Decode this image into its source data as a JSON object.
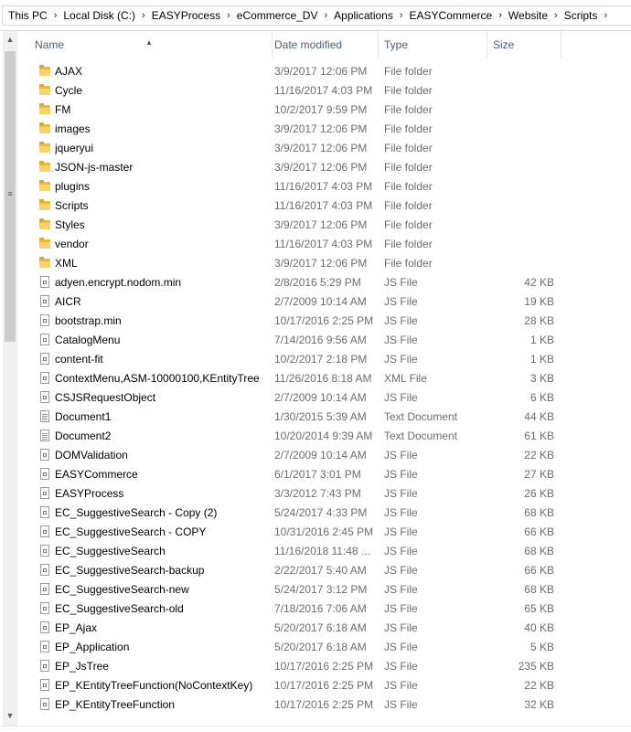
{
  "breadcrumb": [
    "This PC",
    "Local Disk (C:)",
    "EASYProcess",
    "eCommerce_DV",
    "Applications",
    "EASYCommerce",
    "Website",
    "Scripts"
  ],
  "breadcrumb_separator": "›",
  "columns": {
    "name": "Name",
    "date": "Date modified",
    "type": "Type",
    "size": "Size"
  },
  "sort_indicator": "▲",
  "scrollbar": {
    "up": "▲",
    "down": "▼",
    "grip": "≡"
  },
  "files": [
    {
      "name": "AJAX",
      "date": "3/9/2017 12:06 PM",
      "type": "File folder",
      "size": "",
      "icon": "folder-icon"
    },
    {
      "name": "Cycle",
      "date": "11/16/2017 4:03 PM",
      "type": "File folder",
      "size": "",
      "icon": "folder-icon"
    },
    {
      "name": "FM",
      "date": "10/2/2017 9:59 PM",
      "type": "File folder",
      "size": "",
      "icon": "folder-icon"
    },
    {
      "name": "images",
      "date": "3/9/2017 12:06 PM",
      "type": "File folder",
      "size": "",
      "icon": "folder-icon"
    },
    {
      "name": "jqueryui",
      "date": "3/9/2017 12:06 PM",
      "type": "File folder",
      "size": "",
      "icon": "folder-icon"
    },
    {
      "name": "JSON-js-master",
      "date": "3/9/2017 12:06 PM",
      "type": "File folder",
      "size": "",
      "icon": "folder-icon"
    },
    {
      "name": "plugins",
      "date": "11/16/2017 4:03 PM",
      "type": "File folder",
      "size": "",
      "icon": "folder-icon"
    },
    {
      "name": "Scripts",
      "date": "11/16/2017 4:03 PM",
      "type": "File folder",
      "size": "",
      "icon": "folder-icon"
    },
    {
      "name": "Styles",
      "date": "3/9/2017 12:06 PM",
      "type": "File folder",
      "size": "",
      "icon": "folder-icon"
    },
    {
      "name": "vendor",
      "date": "11/16/2017 4:03 PM",
      "type": "File folder",
      "size": "",
      "icon": "folder-icon"
    },
    {
      "name": "XML",
      "date": "3/9/2017 12:06 PM",
      "type": "File folder",
      "size": "",
      "icon": "folder-icon"
    },
    {
      "name": "adyen.encrypt.nodom.min",
      "date": "2/8/2016 5:29 PM",
      "type": "JS File",
      "size": "42 KB",
      "icon": "js-file-icon"
    },
    {
      "name": "AICR",
      "date": "2/7/2009 10:14 AM",
      "type": "JS File",
      "size": "19 KB",
      "icon": "js-file-icon"
    },
    {
      "name": "bootstrap.min",
      "date": "10/17/2016 2:25 PM",
      "type": "JS File",
      "size": "28 KB",
      "icon": "js-file-icon"
    },
    {
      "name": "CatalogMenu",
      "date": "7/14/2016 9:56 AM",
      "type": "JS File",
      "size": "1 KB",
      "icon": "js-file-icon"
    },
    {
      "name": "content-fit",
      "date": "10/2/2017 2:18 PM",
      "type": "JS File",
      "size": "1 KB",
      "icon": "js-file-icon"
    },
    {
      "name": "ContextMenu,ASM-10000100,KEntityTree",
      "date": "11/26/2016 8:18 AM",
      "type": "XML File",
      "size": "3 KB",
      "icon": "xml-file-icon"
    },
    {
      "name": "CSJSRequestObject",
      "date": "2/7/2009 10:14 AM",
      "type": "JS File",
      "size": "6 KB",
      "icon": "js-file-icon"
    },
    {
      "name": "Document1",
      "date": "1/30/2015 5:39 AM",
      "type": "Text Document",
      "size": "44 KB",
      "icon": "text-file-icon"
    },
    {
      "name": "Document2",
      "date": "10/20/2014 9:39 AM",
      "type": "Text Document",
      "size": "61 KB",
      "icon": "text-file-icon"
    },
    {
      "name": "DOMValidation",
      "date": "2/7/2009 10:14 AM",
      "type": "JS File",
      "size": "22 KB",
      "icon": "js-file-icon"
    },
    {
      "name": "EASYCommerce",
      "date": "6/1/2017 3:01 PM",
      "type": "JS File",
      "size": "27 KB",
      "icon": "js-file-icon"
    },
    {
      "name": "EASYProcess",
      "date": "3/3/2012 7:43 PM",
      "type": "JS File",
      "size": "26 KB",
      "icon": "js-file-icon"
    },
    {
      "name": "EC_SuggestiveSearch - Copy (2)",
      "date": "5/24/2017 4:33 PM",
      "type": "JS File",
      "size": "68 KB",
      "icon": "js-file-icon"
    },
    {
      "name": "EC_SuggestiveSearch - COPY",
      "date": "10/31/2016 2:45 PM",
      "type": "JS File",
      "size": "66 KB",
      "icon": "js-file-icon"
    },
    {
      "name": "EC_SuggestiveSearch",
      "date": "11/16/2018 11:48 ...",
      "type": "JS File",
      "size": "68 KB",
      "icon": "js-file-icon"
    },
    {
      "name": "EC_SuggestiveSearch-backup",
      "date": "2/22/2017 5:40 AM",
      "type": "JS File",
      "size": "66 KB",
      "icon": "js-file-icon"
    },
    {
      "name": "EC_SuggestiveSearch-new",
      "date": "5/24/2017 3:12 PM",
      "type": "JS File",
      "size": "68 KB",
      "icon": "js-file-icon"
    },
    {
      "name": "EC_SuggestiveSearch-old",
      "date": "7/18/2016 7:06 AM",
      "type": "JS File",
      "size": "65 KB",
      "icon": "js-file-icon"
    },
    {
      "name": "EP_Ajax",
      "date": "5/20/2017 6:18 AM",
      "type": "JS File",
      "size": "40 KB",
      "icon": "js-file-icon"
    },
    {
      "name": "EP_Application",
      "date": "5/20/2017 6:18 AM",
      "type": "JS File",
      "size": "5 KB",
      "icon": "js-file-icon"
    },
    {
      "name": "EP_JsTree",
      "date": "10/17/2016 2:25 PM",
      "type": "JS File",
      "size": "235 KB",
      "icon": "js-file-icon"
    },
    {
      "name": "EP_KEntityTreeFunction(NoContextKey)",
      "date": "10/17/2016 2:25 PM",
      "type": "JS File",
      "size": "22 KB",
      "icon": "js-file-icon"
    },
    {
      "name": "EP_KEntityTreeFunction",
      "date": "10/17/2016 2:25 PM",
      "type": "JS File",
      "size": "32 KB",
      "icon": "js-file-icon"
    }
  ]
}
